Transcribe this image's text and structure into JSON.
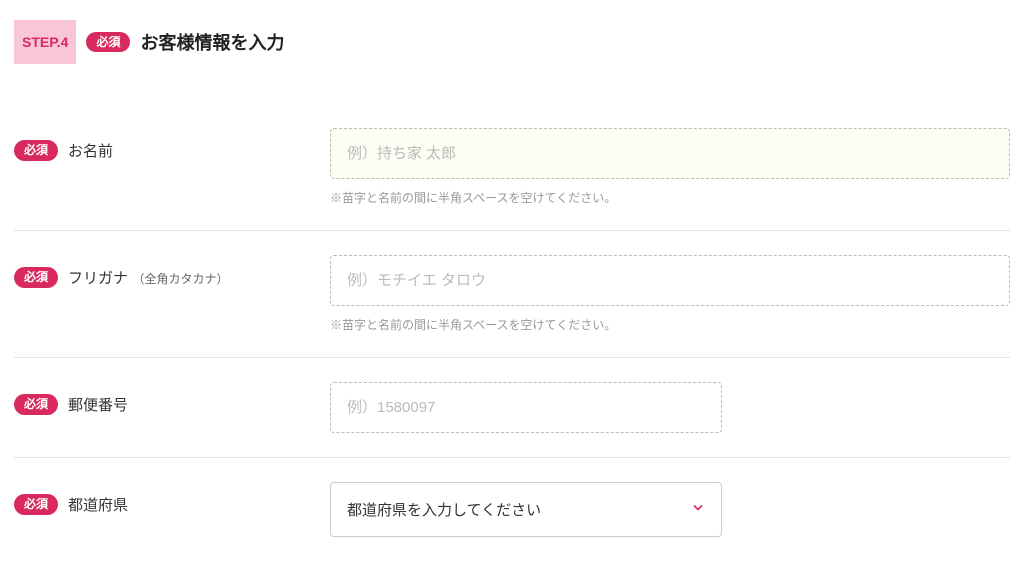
{
  "header": {
    "step_label": "STEP.4",
    "required_badge": "必須",
    "title": "お客様情報を入力"
  },
  "fields": {
    "name": {
      "required_badge": "必須",
      "label": "お名前",
      "placeholder": "例）持ち家 太郎",
      "hint": "※苗字と名前の間に半角スペースを空けてください。"
    },
    "furigana": {
      "required_badge": "必須",
      "label": "フリガナ",
      "sublabel": "（全角カタカナ）",
      "placeholder": "例）モチイエ タロウ",
      "hint": "※苗字と名前の間に半角スペースを空けてください。"
    },
    "postal": {
      "required_badge": "必須",
      "label": "郵便番号",
      "placeholder": "例）1580097"
    },
    "prefecture": {
      "required_badge": "必須",
      "label": "都道府県",
      "selected": "都道府県を入力してください"
    }
  }
}
